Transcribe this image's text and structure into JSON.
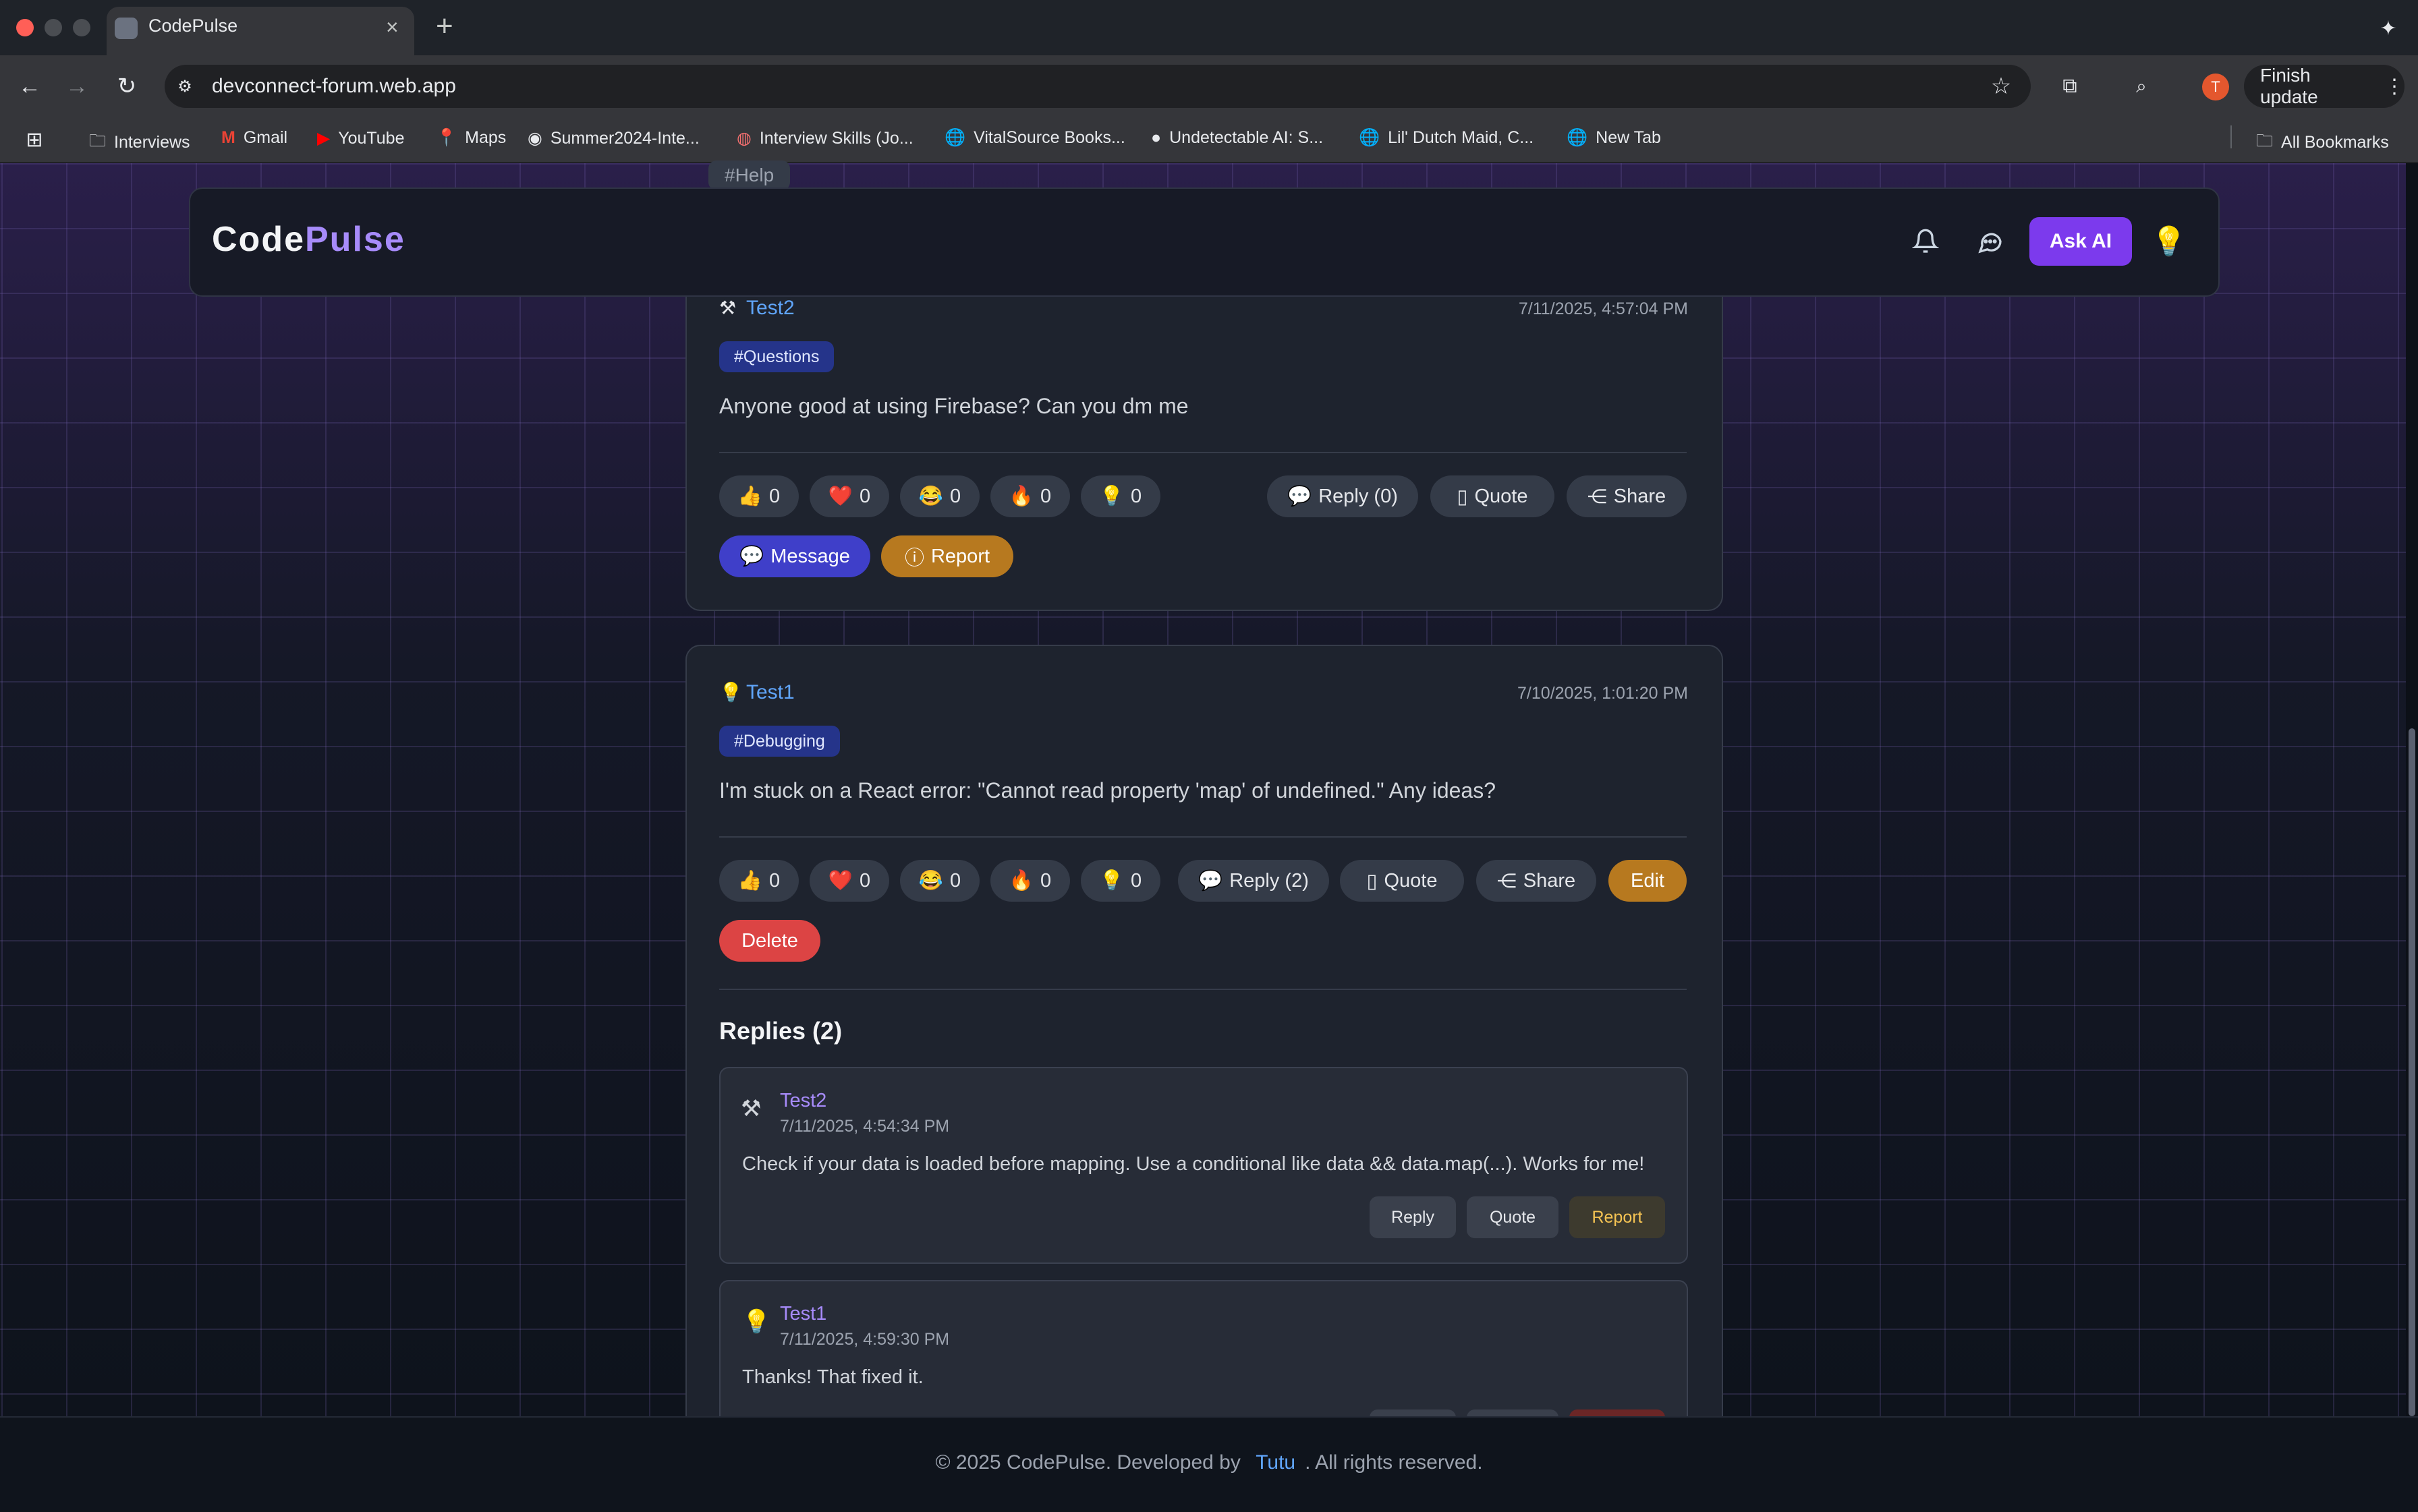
{
  "browser": {
    "tab_title": "CodePulse",
    "url": "devconnect-forum.web.app",
    "finish_update": "Finish update",
    "avatar_letter": "T",
    "bookmarks": [
      "Interviews",
      "Gmail",
      "YouTube",
      "Maps",
      "Summer2024-Inte...",
      "Interview Skills (Jo...",
      "VitalSource Books...",
      "Undetectable AI: S...",
      "Lil' Dutch Maid, C...",
      "New Tab"
    ],
    "all_bookmarks": "All Bookmarks"
  },
  "header": {
    "logo_part1": "Code",
    "logo_part2": "Pulse",
    "ask_ai": "Ask AI",
    "peek_tag": "#Help"
  },
  "posts": [
    {
      "author": "Test2",
      "timestamp": "7/11/2025, 4:57:04 PM",
      "tag": "#Questions",
      "body": "Anyone good at using Firebase? Can you dm me",
      "reactions": [
        "0",
        "0",
        "0",
        "0",
        "0"
      ],
      "reply_label": "Reply (0)",
      "quote_label": "Quote",
      "share_label": "Share",
      "message_label": "Message",
      "report_label": "Report"
    },
    {
      "author": "Test1",
      "timestamp": "7/10/2025, 1:01:20 PM",
      "tag": "#Debugging",
      "body": "I'm stuck on a React error: \"Cannot read property 'map' of undefined.\" Any ideas?",
      "reactions": [
        "0",
        "0",
        "0",
        "0",
        "0"
      ],
      "reply_label": "Reply (2)",
      "quote_label": "Quote",
      "share_label": "Share",
      "edit_label": "Edit",
      "delete_label": "Delete",
      "replies_heading": "Replies (2)",
      "replies": [
        {
          "author": "Test2",
          "timestamp": "7/11/2025, 4:54:34 PM",
          "body": "Check if your data is loaded before mapping. Use a conditional like data && data.map(...). Works for me!",
          "reply_label": "Reply",
          "quote_label": "Quote",
          "report_label": "Report"
        },
        {
          "author": "Test1",
          "timestamp": "7/11/2025, 4:59:30 PM",
          "body": "Thanks! That fixed it."
        }
      ]
    }
  ],
  "footer": {
    "prefix": "© 2025 CodePulse. Developed by",
    "author": "Tutu",
    "suffix": ". All rights reserved."
  },
  "colors": {
    "accent_purple": "#7c3aed",
    "link_blue": "#60a5fa",
    "reply_author": "#a78bfa",
    "message_btn": "#3f3fc9",
    "report_btn": "#b7791f",
    "delete_btn": "#dc4444"
  }
}
